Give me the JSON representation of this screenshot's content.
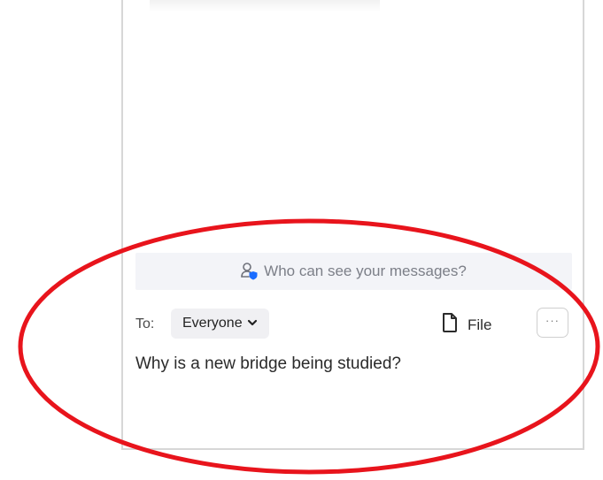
{
  "chat": {
    "visibility_prompt": "Who can see your messages?",
    "to_label": "To:",
    "recipient": "Everyone",
    "file_label": "File",
    "more_label": "···",
    "message_text": "Why is a new bridge being studied?"
  },
  "colors": {
    "annotation": "#e8141c",
    "accent_blue": "#1a6cff",
    "bar_background": "#f3f4f8"
  },
  "icons": {
    "visibility": "person-shield-icon",
    "dropdown": "chevron-down-icon",
    "file": "file-icon",
    "more": "more-horizontal-icon"
  }
}
